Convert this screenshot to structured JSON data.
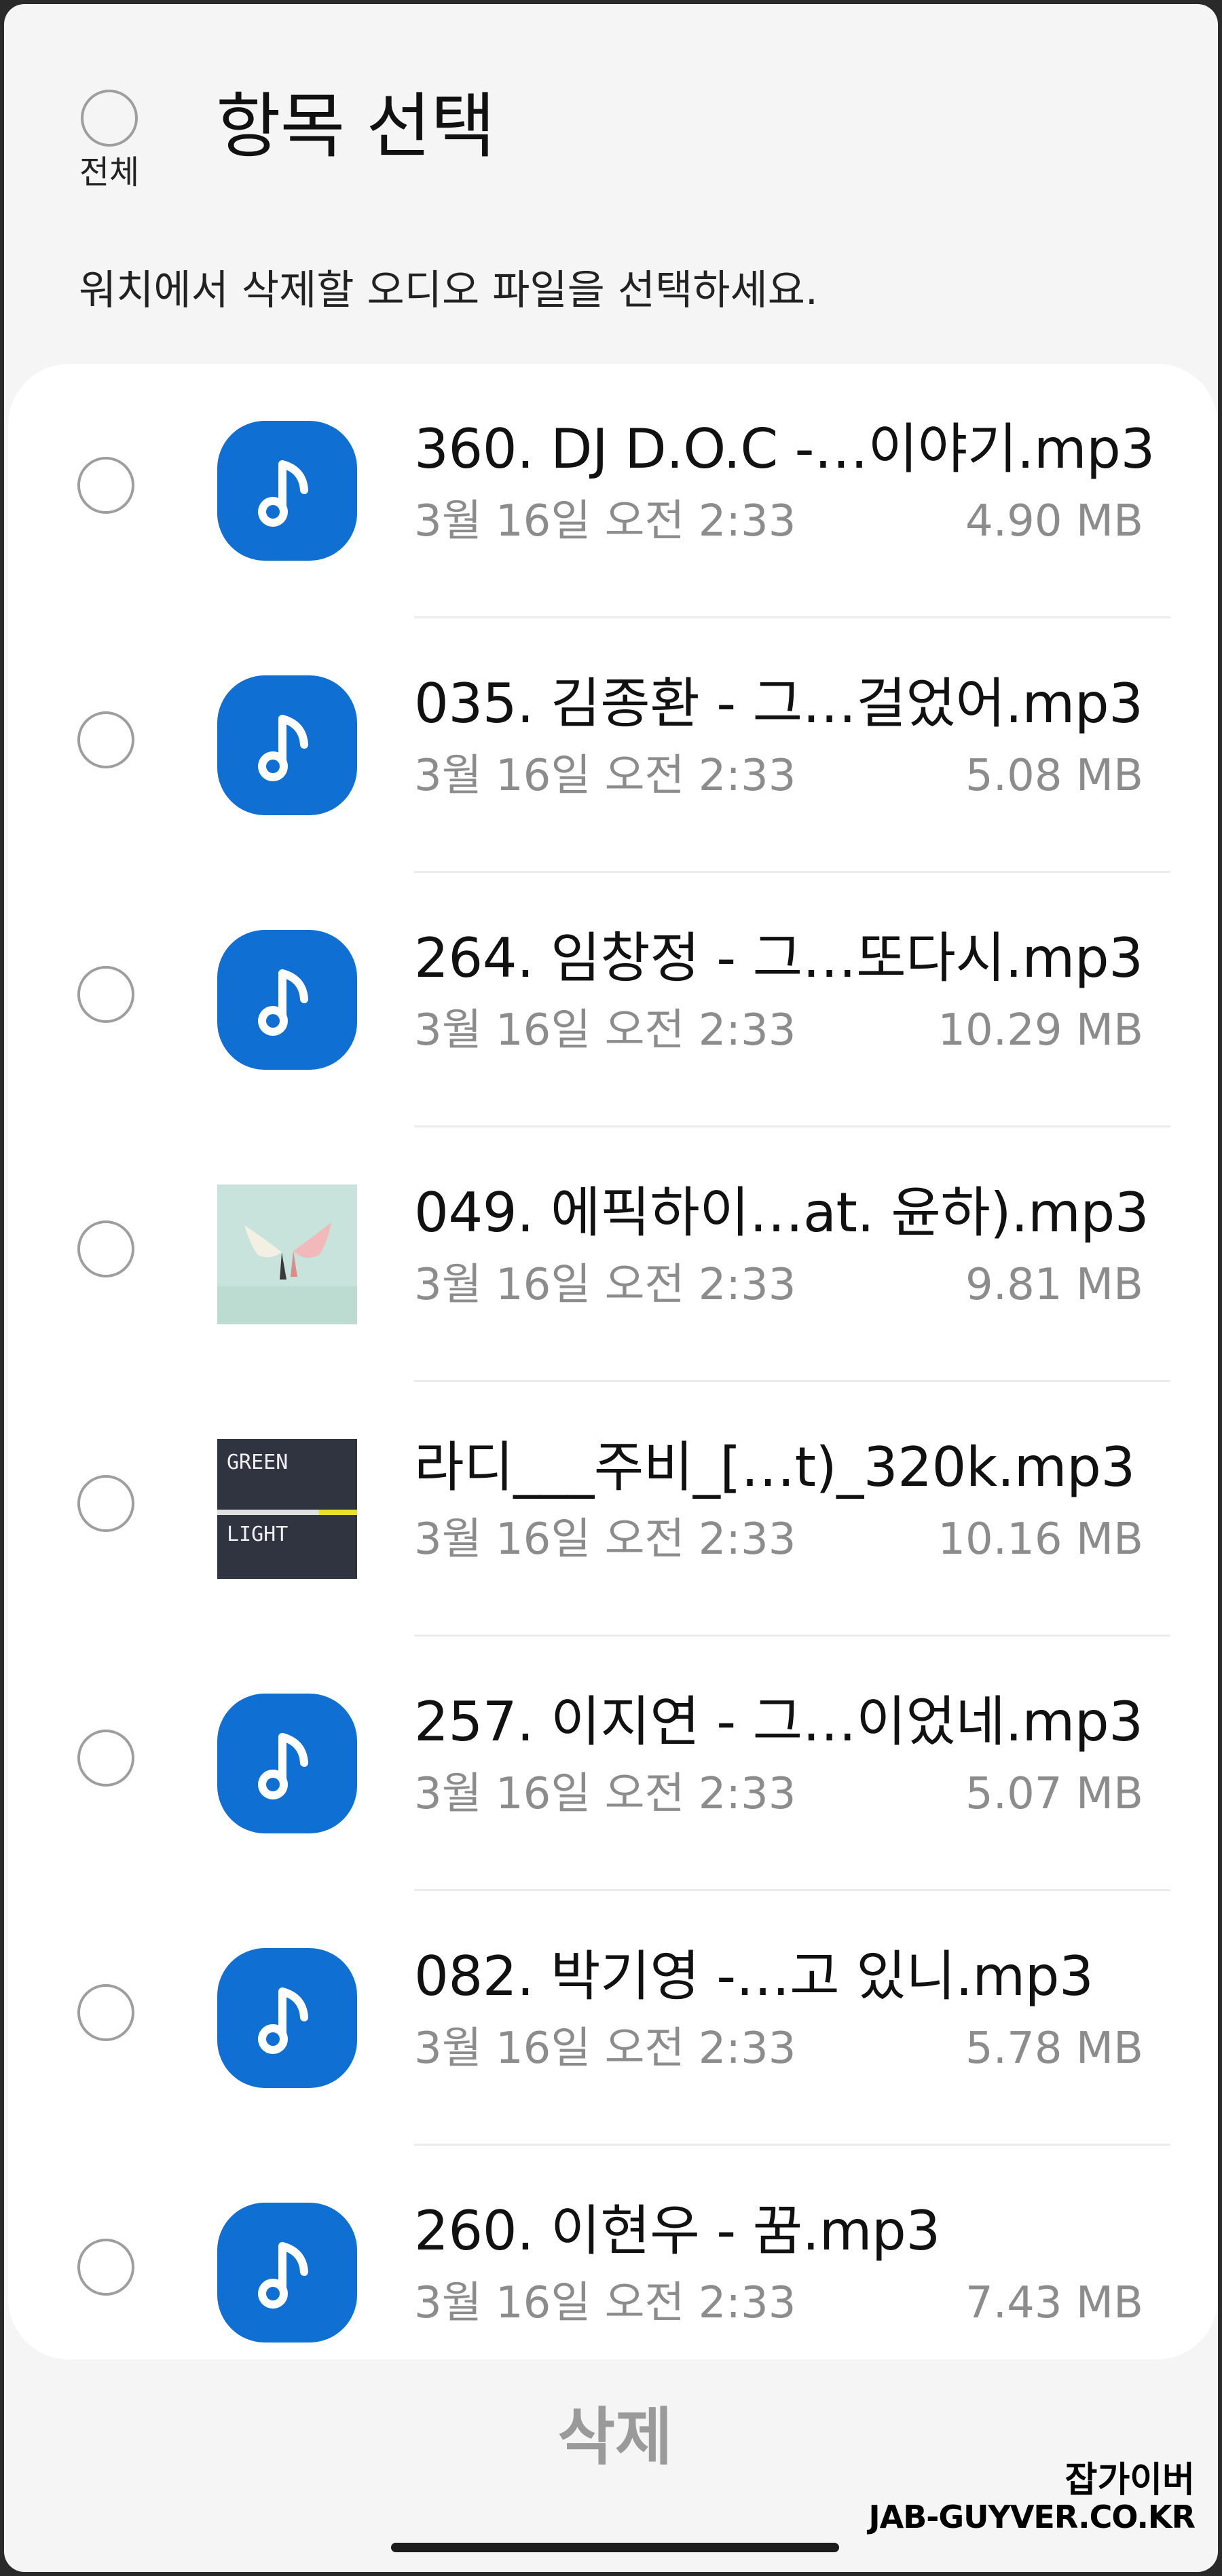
{
  "header": {
    "select_all_label": "전체",
    "title": "항목 선택",
    "subtitle": "워치에서 삭제할 오디오 파일을 선택하세요."
  },
  "files": [
    {
      "name": "360. DJ D.O.C -…이야기.mp3",
      "date": "3월 16일 오전 2:33",
      "size": "4.90 MB",
      "icon": "music-note-icon"
    },
    {
      "name": "035. 김종환 - 그…걸었어.mp3",
      "date": "3월 16일 오전 2:33",
      "size": "5.08 MB",
      "icon": "music-note-icon"
    },
    {
      "name": "264. 임창정 - 그…또다시.mp3",
      "date": "3월 16일 오전 2:33",
      "size": "10.29 MB",
      "icon": "music-note-icon"
    },
    {
      "name": "049. 에픽하이…at. 윤하).mp3",
      "date": "3월 16일 오전 2:33",
      "size": "9.81 MB",
      "icon": "album-art-birds"
    },
    {
      "name": "라디___주비_[…t)_320k.mp3",
      "date": "3월 16일 오전 2:33",
      "size": "10.16 MB",
      "icon": "album-art-green-light",
      "art_text": [
        "GREEN",
        "LIGHT"
      ]
    },
    {
      "name": "257. 이지연 - 그…이었네.mp3",
      "date": "3월 16일 오전 2:33",
      "size": "5.07 MB",
      "icon": "music-note-icon"
    },
    {
      "name": "082. 박기영 -…고 있니.mp3",
      "date": "3월 16일 오전 2:33",
      "size": "5.78 MB",
      "icon": "music-note-icon"
    },
    {
      "name": "260. 이현우 - 꿈.mp3",
      "date": "3월 16일 오전 2:33",
      "size": "7.43 MB",
      "icon": "music-note-icon"
    }
  ],
  "footer": {
    "delete_label": "삭제"
  },
  "watermark": {
    "line1": "잡가이버",
    "line2": "JAB-GUYVER.CO.KR"
  },
  "colors": {
    "accent": "#0f6fd3",
    "background": "#f5f5f5",
    "secondary_text": "#8c8c8c"
  }
}
